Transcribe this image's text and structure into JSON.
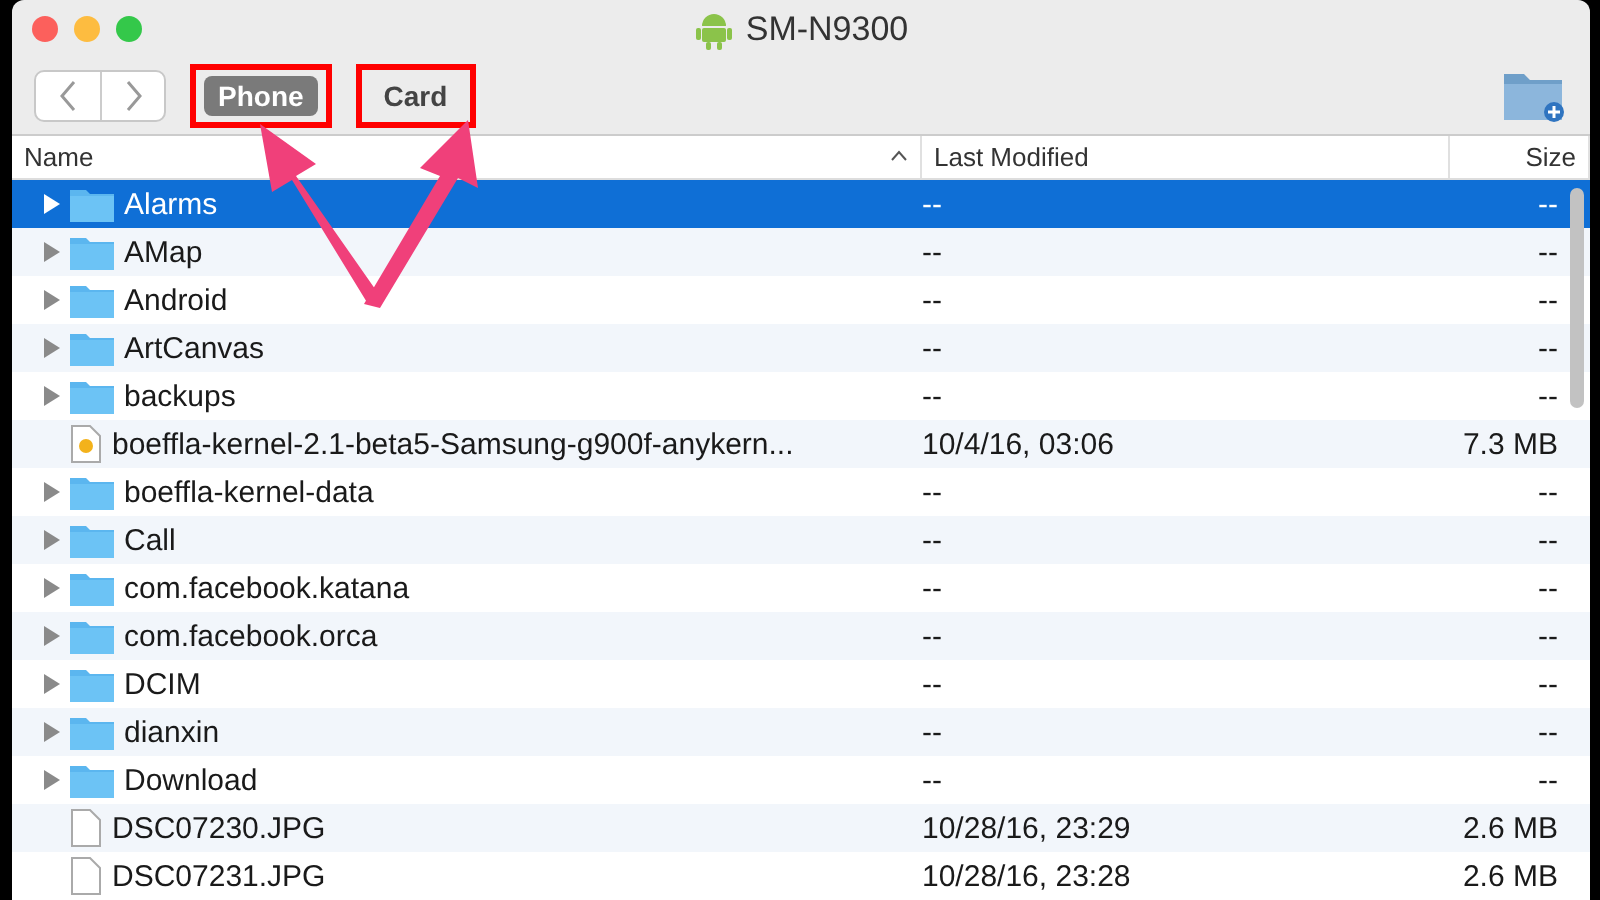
{
  "window": {
    "title": "SM-N9300"
  },
  "tabs": [
    {
      "label": "Phone",
      "selected": true
    },
    {
      "label": "Card",
      "selected": false
    }
  ],
  "table": {
    "columns": [
      {
        "label": "Name",
        "sorted": true
      },
      {
        "label": "Last Modified",
        "sorted": false
      },
      {
        "label": "Size",
        "sorted": false
      }
    ],
    "rows": [
      {
        "kind": "folder",
        "name": "Alarms",
        "modified": "--",
        "size": "--",
        "selected": true
      },
      {
        "kind": "folder",
        "name": "AMap",
        "modified": "--",
        "size": "--",
        "selected": false
      },
      {
        "kind": "folder",
        "name": "Android",
        "modified": "--",
        "size": "--",
        "selected": false
      },
      {
        "kind": "folder",
        "name": "ArtCanvas",
        "modified": "--",
        "size": "--",
        "selected": false
      },
      {
        "kind": "folder",
        "name": "backups",
        "modified": "--",
        "size": "--",
        "selected": false
      },
      {
        "kind": "archive",
        "name": "boeffla-kernel-2.1-beta5-Samsung-g900f-anykern...",
        "modified": "10/4/16, 03:06",
        "size": "7.3 MB",
        "selected": false
      },
      {
        "kind": "folder",
        "name": "boeffla-kernel-data",
        "modified": "--",
        "size": "--",
        "selected": false
      },
      {
        "kind": "folder",
        "name": "Call",
        "modified": "--",
        "size": "--",
        "selected": false
      },
      {
        "kind": "folder",
        "name": "com.facebook.katana",
        "modified": "--",
        "size": "--",
        "selected": false
      },
      {
        "kind": "folder",
        "name": "com.facebook.orca",
        "modified": "--",
        "size": "--",
        "selected": false
      },
      {
        "kind": "folder",
        "name": "DCIM",
        "modified": "--",
        "size": "--",
        "selected": false
      },
      {
        "kind": "folder",
        "name": "dianxin",
        "modified": "--",
        "size": "--",
        "selected": false
      },
      {
        "kind": "folder",
        "name": "Download",
        "modified": "--",
        "size": "--",
        "selected": false
      },
      {
        "kind": "file",
        "name": "DSC07230.JPG",
        "modified": "10/28/16, 23:29",
        "size": "2.6 MB",
        "selected": false
      },
      {
        "kind": "file",
        "name": "DSC07231.JPG",
        "modified": "10/28/16, 23:28",
        "size": "2.6 MB",
        "selected": false
      }
    ]
  }
}
